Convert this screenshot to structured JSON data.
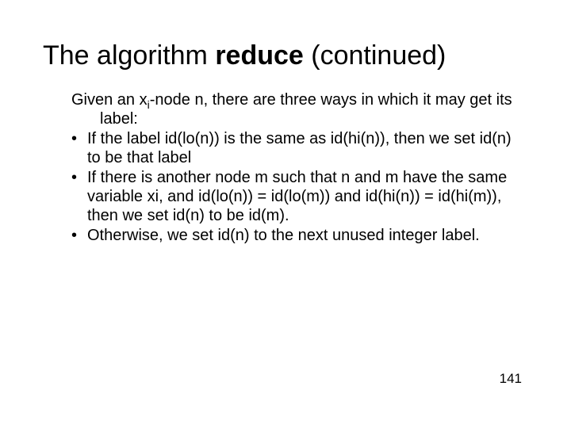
{
  "title": {
    "pre": "The algorithm ",
    "bold": "reduce",
    "post": " (continued)"
  },
  "intro": {
    "before_sub": "Given an x",
    "sub": "i",
    "after_sub": "-node n, there are three ways in which it may get its label:"
  },
  "bullets": [
    {
      "marker": "•",
      "text": "If the label id(lo(n)) is the same as id(hi(n)),  then we set id(n) to be that label"
    },
    {
      "marker": "•",
      "before_sub": "If there is another node m such that n and m have the same variable x",
      "sub": "i",
      "after_sub": ", and id(lo(n)) = id(lo(m)) and id(hi(n)) = id(hi(m)), then we set id(n) to be id(m)."
    },
    {
      "marker": "•",
      "text": "Otherwise, we set id(n) to the next unused integer label."
    }
  ],
  "page_number": "141"
}
